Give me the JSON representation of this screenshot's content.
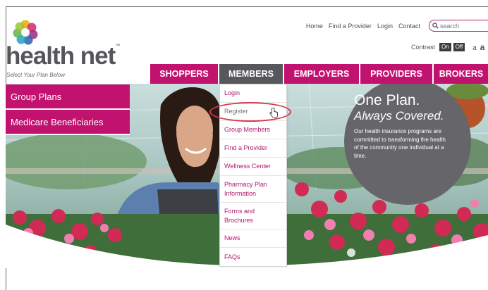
{
  "brand": {
    "name": "health net",
    "tm": "™",
    "tagline": "Select Your Plan Below"
  },
  "top_links": [
    "Home",
    "Find a Provider",
    "Login",
    "Contact"
  ],
  "search": {
    "placeholder": "search"
  },
  "contrast": {
    "label": "Contrast",
    "on": "On",
    "off": "Off",
    "text_small": "a",
    "text_large": "a"
  },
  "nav": [
    {
      "label": "SHOPPERS",
      "width": 98
    },
    {
      "label": "MEMBERS",
      "width": 92,
      "active": true
    },
    {
      "label": "EMPLOYERS",
      "width": 108
    },
    {
      "label": "PROVIDERS",
      "width": 104
    },
    {
      "label": "BROKERS",
      "width": 80
    }
  ],
  "left_menu": [
    "Group Plans",
    "Medicare Beneficiaries"
  ],
  "members_dropdown": [
    "Login",
    "Register",
    "Group Members",
    "Find a Provider",
    "Wellness Center",
    "Pharmacy Plan Information",
    "Forms and Brochures",
    "News",
    "FAQs"
  ],
  "hero": {
    "title": "One Plan.",
    "subtitle": "Always Covered.",
    "body": "Our health insurance programs are committed to transforming the health of the community one individual at a time."
  },
  "colors": {
    "brand_magenta": "#c2126f",
    "active_tab": "#58585c",
    "highlight": "#d4394a"
  }
}
